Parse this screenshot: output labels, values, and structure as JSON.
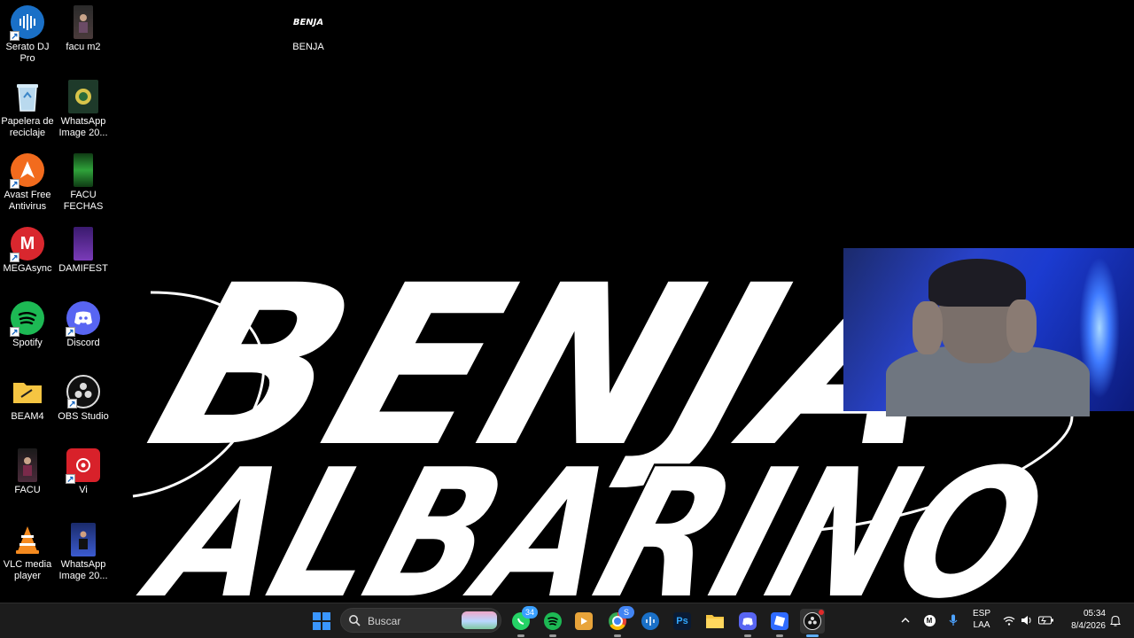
{
  "desktop": {
    "icons": [
      {
        "label": "Serato DJ Pro",
        "icon": "serato-icon",
        "shortcut": true
      },
      {
        "label": "facu m2",
        "icon": "photo-thumb-icon",
        "shortcut": false
      },
      {
        "label": "BENJA",
        "icon": "benja-logo-icon",
        "shortcut": false
      },
      {
        "label": "Papelera de\nreciclaje",
        "icon": "recycle-bin-icon",
        "shortcut": false
      },
      {
        "label": "WhatsApp\nImage 20...",
        "icon": "image-thumb-icon",
        "shortcut": false
      },
      {
        "label": "Avast Free\nAntivirus",
        "icon": "avast-icon",
        "shortcut": true
      },
      {
        "label": "FACU\nFECHAS",
        "icon": "image-thumb-icon",
        "shortcut": false
      },
      {
        "label": "MEGAsync",
        "icon": "mega-icon",
        "shortcut": true
      },
      {
        "label": "DAMIFEST",
        "icon": "image-thumb-icon",
        "shortcut": false
      },
      {
        "label": "Spotify",
        "icon": "spotify-icon",
        "shortcut": true
      },
      {
        "label": "Discord",
        "icon": "discord-icon",
        "shortcut": true
      },
      {
        "label": "BEAM4",
        "icon": "folder-icon",
        "shortcut": false
      },
      {
        "label": "OBS Studio",
        "icon": "obs-icon",
        "shortcut": true
      },
      {
        "label": "FACU",
        "icon": "image-thumb-icon",
        "shortcut": false
      },
      {
        "label": "Vi",
        "icon": "app-icon",
        "shortcut": true
      },
      {
        "label": "VLC media\nplayer",
        "icon": "vlc-icon",
        "shortcut": false
      },
      {
        "label": "WhatsApp\nImage 20...",
        "icon": "image-thumb-icon",
        "shortcut": false
      }
    ]
  },
  "wallpaper": {
    "line1": "BENJA",
    "line2": "ALBARINO"
  },
  "taskbar": {
    "search_label": "Buscar",
    "whatsapp_badge": "34",
    "chrome_badge": "S",
    "apps": [
      "start",
      "search",
      "whatsapp",
      "spotify",
      "media-player",
      "chrome",
      "serato",
      "photoshop",
      "file-explorer",
      "discord",
      "roblox",
      "obs"
    ],
    "photoshop_text": "Ps"
  },
  "tray": {
    "lang_line1": "ESP",
    "lang_line2": "LAA",
    "time": "05:34",
    "date": "8/4/2026"
  },
  "colors": {
    "taskbar_bg": "#1c1c1c",
    "windows_blue": "#3a96ff",
    "spotify_green": "#1db954",
    "discord_blurple": "#5865f2",
    "avast_orange": "#f26b1d",
    "mega_red": "#d9272e"
  }
}
